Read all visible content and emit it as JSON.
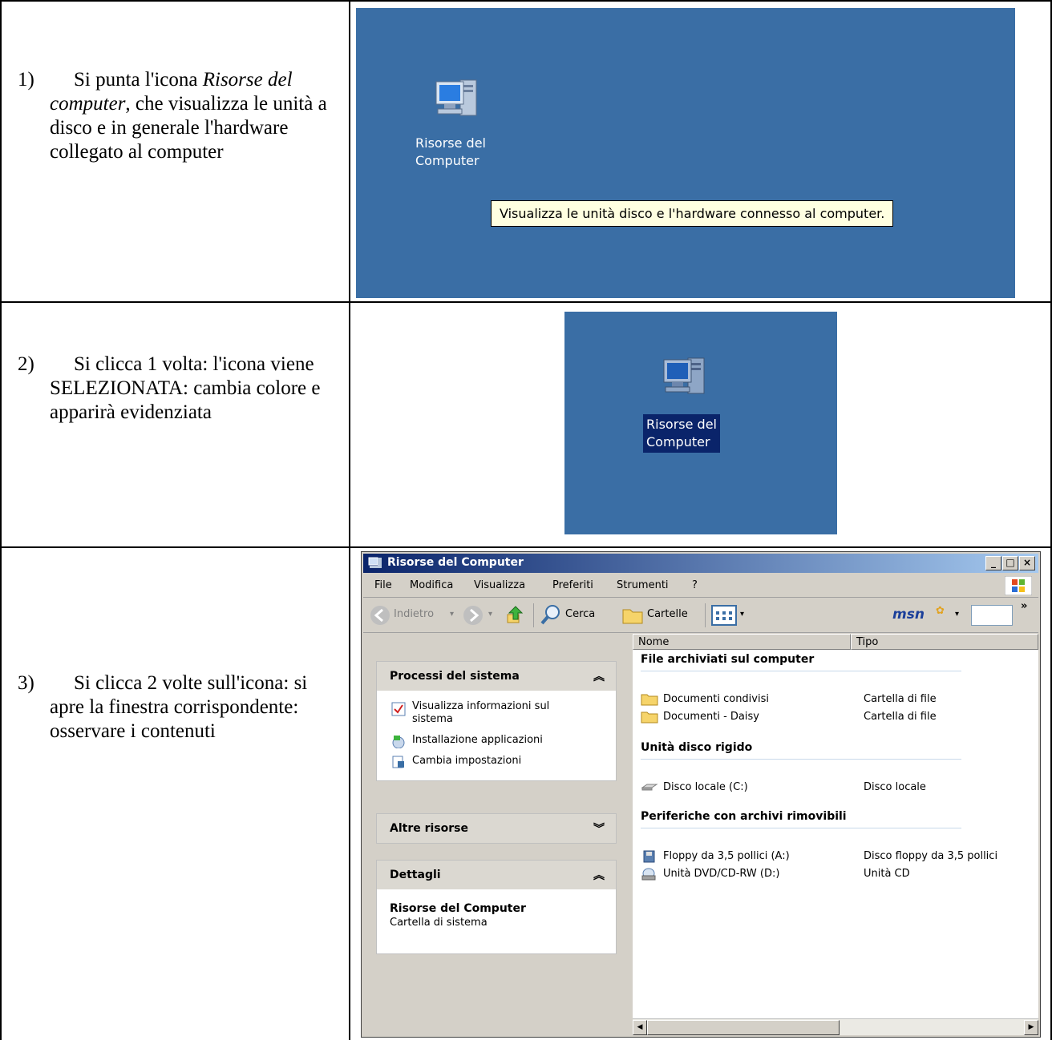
{
  "row1": {
    "number": "1)",
    "text_start": "Si punta l'icona",
    "text_italic": "Risorse del computer",
    "text_end": ", che visualizza le unità a disco e in generale l'hardware collegato al computer",
    "icon_label_line1": "Risorse del",
    "icon_label_line2": "Computer",
    "tooltip": "Visualizza le unità disco e l'hardware connesso al computer."
  },
  "row2": {
    "number": "2)",
    "text": "Si clicca 1 volta: l'icona viene SELEZIONATA: cambia colore e apparirà evidenziata",
    "icon_label_line1": "Risorse del",
    "icon_label_line2": "Computer"
  },
  "row3": {
    "number": "3)",
    "text": "Si clicca 2 volte sull'icona: si apre la finestra corrispondente: osservare i contenuti"
  },
  "window": {
    "title": "Risorse del Computer",
    "menu": [
      "File",
      "Modifica",
      "Visualizza",
      "Preferiti",
      "Strumenti",
      "?"
    ],
    "toolbar": {
      "back": "Indietro",
      "search": "Cerca",
      "folders": "Cartelle",
      "msn": "msn"
    },
    "left_panels": {
      "system_tasks": {
        "title": "Processi del sistema",
        "items": [
          "Visualizza informazioni sul sistema",
          "Installazione applicazioni",
          "Cambia impostazioni"
        ]
      },
      "other_places": {
        "title": "Altre risorse"
      },
      "details": {
        "title": "Dettagli",
        "name": "Risorse del Computer",
        "type": "Cartella di sistema"
      }
    },
    "columns": [
      "Nome",
      "Tipo"
    ],
    "groups": [
      {
        "title": "File archiviati sul computer",
        "items": [
          {
            "name": "Documenti condivisi",
            "type": "Cartella di file",
            "icon": "folder-icon"
          },
          {
            "name": "Documenti - Daisy",
            "type": "Cartella di file",
            "icon": "folder-icon"
          }
        ]
      },
      {
        "title": "Unità disco rigido",
        "items": [
          {
            "name": "Disco locale (C:)",
            "type": "Disco locale",
            "icon": "hard-disk-icon"
          }
        ]
      },
      {
        "title": "Periferiche con archivi rimovibili",
        "items": [
          {
            "name": "Floppy da 3,5 pollici (A:)",
            "type": "Disco floppy da 3,5 pollici",
            "icon": "floppy-icon"
          },
          {
            "name": "Unità DVD/CD-RW (D:)",
            "type": "Unità CD",
            "icon": "cd-drive-icon"
          }
        ]
      }
    ]
  }
}
